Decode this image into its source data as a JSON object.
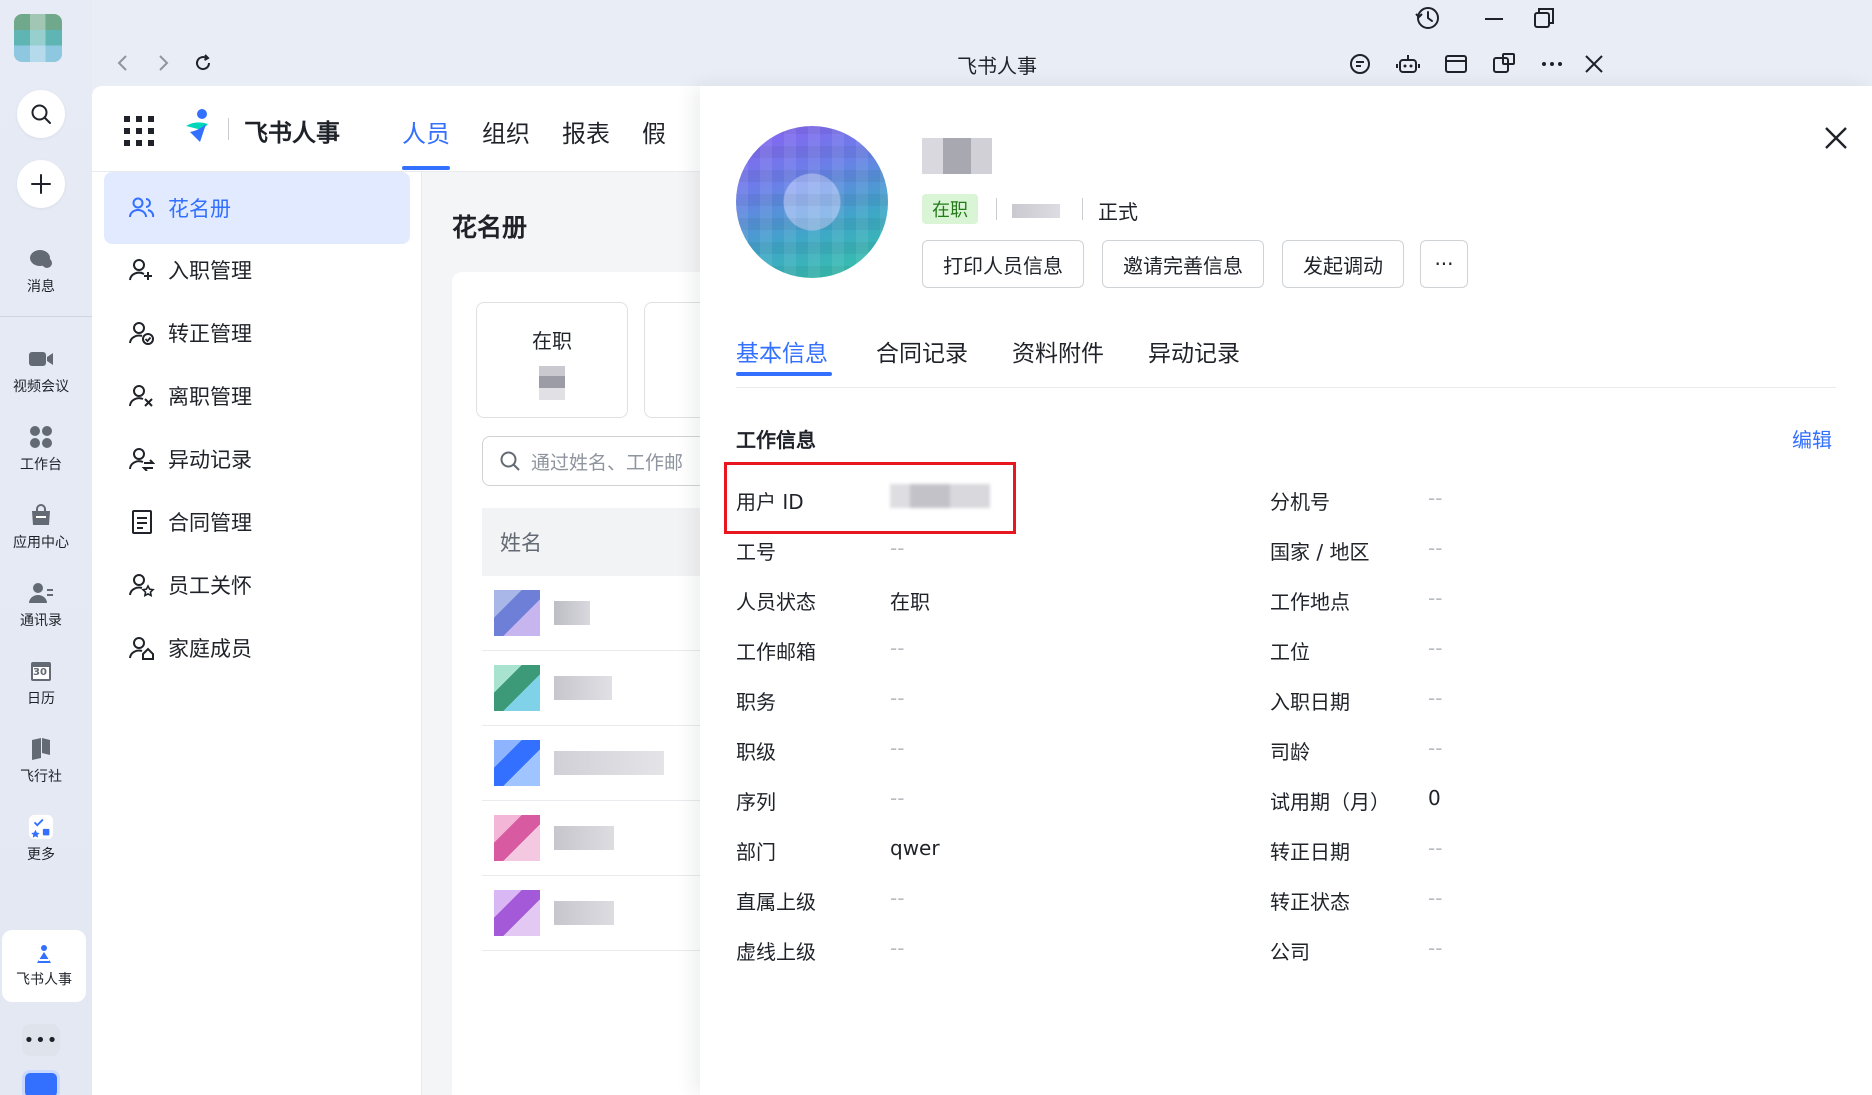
{
  "rail": {
    "items": [
      {
        "label": "消息",
        "icon": "chat-bubble-icon"
      },
      {
        "label": "视频会议",
        "icon": "video-camera-icon"
      },
      {
        "label": "工作台",
        "icon": "grid-dots-icon"
      },
      {
        "label": "应用中心",
        "icon": "shopping-bag-icon"
      },
      {
        "label": "通讯录",
        "icon": "contacts-icon"
      },
      {
        "label": "日历",
        "icon": "calendar-icon"
      },
      {
        "label": "飞行社",
        "icon": "flag-icon"
      },
      {
        "label": "更多",
        "icon": "more-apps-icon"
      }
    ],
    "active_app": "飞书人事",
    "calendar_day": "30"
  },
  "window": {
    "title": "飞书人事"
  },
  "app": {
    "brand": "飞书人事",
    "topnav": [
      "人员",
      "组织",
      "报表",
      "假"
    ],
    "sidebar": [
      {
        "label": "花名册",
        "icon": "people-icon"
      },
      {
        "label": "入职管理",
        "icon": "user-add-icon"
      },
      {
        "label": "转正管理",
        "icon": "user-check-icon"
      },
      {
        "label": "离职管理",
        "icon": "user-remove-icon"
      },
      {
        "label": "异动记录",
        "icon": "user-transfer-icon"
      },
      {
        "label": "合同管理",
        "icon": "document-icon"
      },
      {
        "label": "员工关怀",
        "icon": "user-star-icon"
      },
      {
        "label": "家庭成员",
        "icon": "user-home-icon"
      }
    ],
    "content_title": "花名册",
    "stat_card_label": "在职",
    "search_placeholder": "通过姓名、工作邮",
    "table_header_name": "姓名"
  },
  "drawer": {
    "status_badge": "在职",
    "employment_type": "正式",
    "actions": [
      "打印人员信息",
      "邀请完善信息",
      "发起调动",
      "···"
    ],
    "tabs": [
      "基本信息",
      "合同记录",
      "资料附件",
      "异动记录"
    ],
    "section_title": "工作信息",
    "edit_label": "编辑",
    "fields_left": [
      {
        "label": "用户 ID",
        "value": ""
      },
      {
        "label": "工号",
        "value": "--"
      },
      {
        "label": "人员状态",
        "value": "在职"
      },
      {
        "label": "工作邮箱",
        "value": "--"
      },
      {
        "label": "职务",
        "value": "--"
      },
      {
        "label": "职级",
        "value": "--"
      },
      {
        "label": "序列",
        "value": "--"
      },
      {
        "label": "部门",
        "value": "qwer"
      },
      {
        "label": "直属上级",
        "value": "--"
      },
      {
        "label": "虚线上级",
        "value": "--"
      }
    ],
    "fields_right": [
      {
        "label": "分机号",
        "value": "--"
      },
      {
        "label": "国家 / 地区",
        "value": "--"
      },
      {
        "label": "工作地点",
        "value": "--"
      },
      {
        "label": "工位",
        "value": "--"
      },
      {
        "label": "入职日期",
        "value": "--"
      },
      {
        "label": "司龄",
        "value": "--"
      },
      {
        "label": "试用期（月）",
        "value": "0"
      },
      {
        "label": "转正日期",
        "value": "--"
      },
      {
        "label": "转正状态",
        "value": "--"
      },
      {
        "label": "公司",
        "value": "--"
      }
    ]
  },
  "colors": {
    "accent": "#3370ff",
    "highlight": "#e8161f",
    "status_green_bg": "#d9f5d6",
    "status_green_text": "#237b19"
  }
}
